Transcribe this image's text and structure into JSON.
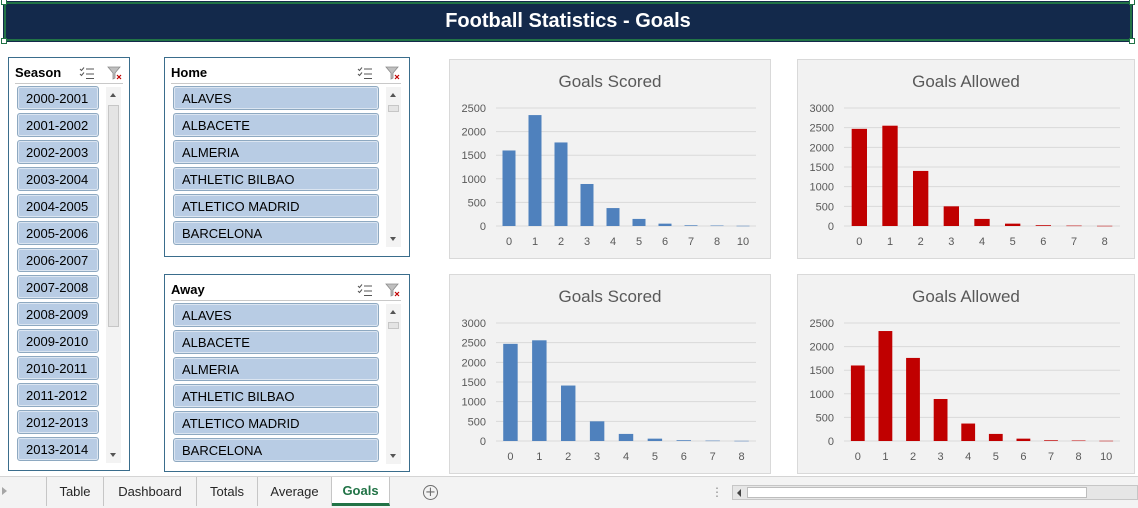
{
  "title": "Football Statistics - Goals",
  "slicers": {
    "season": {
      "title": "Season",
      "items": [
        "2000-2001",
        "2001-2002",
        "2002-2003",
        "2003-2004",
        "2004-2005",
        "2005-2006",
        "2006-2007",
        "2007-2008",
        "2008-2009",
        "2009-2010",
        "2010-2011",
        "2011-2012",
        "2012-2013",
        "2013-2014"
      ]
    },
    "home": {
      "title": "Home",
      "items": [
        "ALAVES",
        "ALBACETE",
        "ALMERIA",
        "ATHLETIC BILBAO",
        "ATLETICO MADRID",
        "BARCELONA"
      ]
    },
    "away": {
      "title": "Away",
      "items": [
        "ALAVES",
        "ALBACETE",
        "ALMERIA",
        "ATHLETIC BILBAO",
        "ATLETICO MADRID",
        "BARCELONA"
      ]
    },
    "icons": [
      "multi-select-icon",
      "clear-filter-icon"
    ]
  },
  "chart_data": [
    {
      "type": "bar",
      "title": "Goals Scored",
      "color": "#4f81bd",
      "categories": [
        "0",
        "1",
        "2",
        "3",
        "4",
        "5",
        "6",
        "7",
        "8",
        "10"
      ],
      "values": [
        1600,
        2350,
        1770,
        890,
        380,
        150,
        50,
        15,
        10,
        5
      ],
      "ylim": [
        0,
        2500
      ],
      "yticks": [
        0,
        500,
        1000,
        1500,
        2000,
        2500
      ]
    },
    {
      "type": "bar",
      "title": "Goals Allowed",
      "color": "#c00000",
      "categories": [
        "0",
        "1",
        "2",
        "3",
        "4",
        "5",
        "6",
        "7",
        "8"
      ],
      "values": [
        2470,
        2550,
        1400,
        500,
        180,
        60,
        20,
        10,
        5
      ],
      "ylim": [
        0,
        3000
      ],
      "yticks": [
        0,
        500,
        1000,
        1500,
        2000,
        2500,
        3000
      ]
    },
    {
      "type": "bar",
      "title": "Goals Scored",
      "color": "#4f81bd",
      "categories": [
        "0",
        "1",
        "2",
        "3",
        "4",
        "5",
        "6",
        "7",
        "8"
      ],
      "values": [
        2470,
        2560,
        1410,
        500,
        180,
        60,
        20,
        10,
        5
      ],
      "ylim": [
        0,
        3000
      ],
      "yticks": [
        0,
        500,
        1000,
        1500,
        2000,
        2500,
        3000
      ]
    },
    {
      "type": "bar",
      "title": "Goals Allowed",
      "color": "#c00000",
      "categories": [
        "0",
        "1",
        "2",
        "3",
        "4",
        "5",
        "6",
        "7",
        "8",
        "10"
      ],
      "values": [
        1600,
        2330,
        1760,
        890,
        370,
        150,
        50,
        15,
        10,
        5
      ],
      "ylim": [
        0,
        2500
      ],
      "yticks": [
        0,
        500,
        1000,
        1500,
        2000,
        2500
      ]
    }
  ],
  "tabs": [
    {
      "label": "Table",
      "active": false
    },
    {
      "label": "Dashboard",
      "active": false
    },
    {
      "label": "Totals",
      "active": false
    },
    {
      "label": "Average",
      "active": false
    },
    {
      "label": "Goals",
      "active": true
    }
  ],
  "tab_add_label": "+",
  "tabbar_dots": "⋮"
}
